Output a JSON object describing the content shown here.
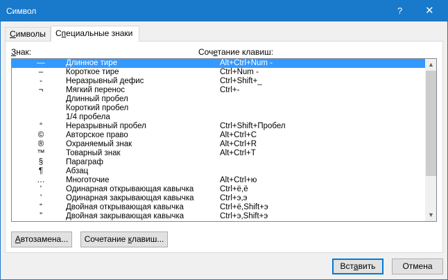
{
  "window": {
    "title": "Символ",
    "help_glyph": "?",
    "close_glyph": "✕"
  },
  "tabs": [
    {
      "label": "Символы",
      "underline": "С",
      "rest": "имволы",
      "selected": false
    },
    {
      "label": "Специальные знаки",
      "underline": "п",
      "before": "С",
      "rest": "ециальные знаки",
      "selected": true
    }
  ],
  "list": {
    "header_sign_underline": "З",
    "header_sign_rest": "нак:",
    "header_keys_before": "Соч",
    "header_keys_underline": "е",
    "header_keys_rest": "тание клавиш:",
    "rows": [
      {
        "sym": "—",
        "name": "Длинное тире",
        "keys": "Alt+Ctrl+Num -",
        "selected": true
      },
      {
        "sym": "–",
        "name": "Короткое тире",
        "keys": "Ctrl+Num -",
        "selected": false
      },
      {
        "sym": "-",
        "name": "Неразрывный дефис",
        "keys": "Ctrl+Shift+_",
        "selected": false
      },
      {
        "sym": "¬",
        "name": "Мягкий перенос",
        "keys": "Ctrl+-",
        "selected": false
      },
      {
        "sym": "",
        "name": "Длинный пробел",
        "keys": "",
        "selected": false
      },
      {
        "sym": "",
        "name": "Короткий пробел",
        "keys": "",
        "selected": false
      },
      {
        "sym": "",
        "name": "1/4 пробела",
        "keys": "",
        "selected": false
      },
      {
        "sym": "°",
        "name": "Неразрывный пробел",
        "keys": "Ctrl+Shift+Пробел",
        "selected": false
      },
      {
        "sym": "©",
        "name": "Авторское право",
        "keys": "Alt+Ctrl+C",
        "selected": false
      },
      {
        "sym": "®",
        "name": "Охраняемый знак",
        "keys": "Alt+Ctrl+R",
        "selected": false
      },
      {
        "sym": "™",
        "name": "Товарный знак",
        "keys": "Alt+Ctrl+T",
        "selected": false
      },
      {
        "sym": "§",
        "name": "Параграф",
        "keys": "",
        "selected": false
      },
      {
        "sym": "¶",
        "name": "Абзац",
        "keys": "",
        "selected": false
      },
      {
        "sym": "…",
        "name": "Многоточие",
        "keys": "Alt+Ctrl+ю",
        "selected": false
      },
      {
        "sym": "‘",
        "name": "Одинарная открывающая кавычка",
        "keys": "Ctrl+ё,ё",
        "selected": false
      },
      {
        "sym": "’",
        "name": "Одинарная закрывающая кавычка",
        "keys": "Ctrl+э,э",
        "selected": false
      },
      {
        "sym": "“",
        "name": "Двойная открывающая кавычка",
        "keys": "Ctrl+ё,Shift+э",
        "selected": false
      },
      {
        "sym": "”",
        "name": "Двойная закрывающая кавычка",
        "keys": "Ctrl+э,Shift+э",
        "selected": false
      }
    ]
  },
  "scrollbar": {
    "up_glyph": "▲",
    "down_glyph": "▼"
  },
  "buttons": {
    "autocorrect_underline": "А",
    "autocorrect_rest": "втозамена...",
    "shortcut_before": "Сочетание ",
    "shortcut_underline": "к",
    "shortcut_rest": "лавиш...",
    "insert_before": "Вст",
    "insert_underline": "а",
    "insert_rest": "вить",
    "cancel": "Отмена"
  }
}
